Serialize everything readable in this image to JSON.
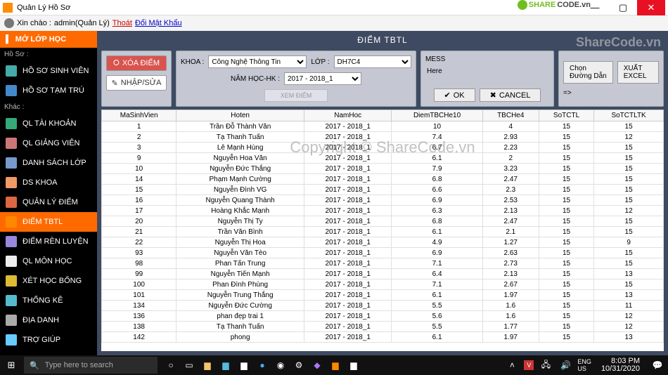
{
  "window": {
    "title": "Quản Lý Hồ Sơ"
  },
  "user": {
    "prefix": "Xin chào :",
    "name": "admin(Quản Lý)",
    "logout": "Thoát",
    "changepw": "Đổi Mật Khẩu"
  },
  "sidebar": {
    "header": "MỞ LỚP HỌC",
    "group1_label": "Hồ Sơ :",
    "group2_label": "Khác :",
    "items1": [
      {
        "label": "HỒ SƠ SINH VIÊN",
        "color": "#4aa"
      },
      {
        "label": "HỒ SƠ TẠM TRÚ",
        "color": "#48c"
      }
    ],
    "items2": [
      {
        "label": "QL TÀI KHOẢN",
        "color": "#3a7"
      },
      {
        "label": "QL GIẢNG VIÊN",
        "color": "#c77"
      },
      {
        "label": "DANH SÁCH LỚP",
        "color": "#79c"
      },
      {
        "label": "DS KHOA",
        "color": "#e96"
      },
      {
        "label": "QUẢN LÝ ĐIỂM",
        "color": "#d64"
      },
      {
        "label": "ĐIỂM TBTL",
        "color": "#f80",
        "active": true
      },
      {
        "label": "ĐIỂM RÈN LUYỆN",
        "color": "#98d"
      },
      {
        "label": "QL MÔN HỌC",
        "color": "#eee"
      },
      {
        "label": "XÉT HỌC BỔNG",
        "color": "#db3"
      },
      {
        "label": "THỐNG KÊ",
        "color": "#5bc"
      },
      {
        "label": "ĐỊA DANH",
        "color": "#aaa"
      },
      {
        "label": "TRỢ GIÚP",
        "color": "#6cf"
      }
    ]
  },
  "page": {
    "title": "ĐIỂM TBTL"
  },
  "leftbtns": {
    "xd": "XÓA ĐIỂM",
    "ns": "NHẬP/SỬA"
  },
  "filters": {
    "khoa_label": "KHOA :",
    "khoa_value": "Công Nghệ Thông Tin",
    "lop_label": "LỚP :",
    "lop_value": "DH7C4",
    "nam_label": "NĂM HỌC-HK :",
    "nam_value": "2017 - 2018_1",
    "xem": "XEM ĐIỂM"
  },
  "mess": {
    "label": "MESS",
    "text": "Here",
    "ok": "OK",
    "cancel": "CANCEL"
  },
  "export": {
    "path": "Chọn Đường Dẫn",
    "excel": "XUẤT EXCEL",
    "arrow": "=>"
  },
  "table": {
    "headers": [
      "MaSinhVien",
      "Hoten",
      "NamHoc",
      "DiemTBCHe10",
      "TBCHe4",
      "SoTCTL",
      "SoTCTLTK"
    ],
    "rows": [
      [
        "1",
        "Trần Đỗ Thành Văn",
        "2017 - 2018_1",
        "10",
        "4",
        "15",
        "15"
      ],
      [
        "2",
        "Tạ Thanh Tuấn",
        "2017 - 2018_1",
        "7.4",
        "2.93",
        "15",
        "12"
      ],
      [
        "3",
        "Lê Mạnh Hùng",
        "2017 - 2018_1",
        "6.7",
        "2.23",
        "15",
        "15"
      ],
      [
        "9",
        "Nguyễn Hoa Văn",
        "2017 - 2018_1",
        "6.1",
        "2",
        "15",
        "15"
      ],
      [
        "10",
        "Nguyễn Đức Thắng",
        "2017 - 2018_1",
        "7.9",
        "3.23",
        "15",
        "15"
      ],
      [
        "14",
        "Phạm Mạnh Cường",
        "2017 - 2018_1",
        "6.8",
        "2.47",
        "15",
        "15"
      ],
      [
        "15",
        "Nguyễn Đình VG",
        "2017 - 2018_1",
        "6.6",
        "2.3",
        "15",
        "15"
      ],
      [
        "16",
        "Nguyễn Quang Thành",
        "2017 - 2018_1",
        "6.9",
        "2.53",
        "15",
        "15"
      ],
      [
        "17",
        "Hoàng Khắc Mạnh",
        "2017 - 2018_1",
        "6.3",
        "2.13",
        "15",
        "12"
      ],
      [
        "20",
        "Nguyễn Thị Ty",
        "2017 - 2018_1",
        "6.8",
        "2.47",
        "15",
        "15"
      ],
      [
        "21",
        "Trần Văn Bình",
        "2017 - 2018_1",
        "6.1",
        "2.1",
        "15",
        "15"
      ],
      [
        "22",
        "Nguyễn Thị Hoa",
        "2017 - 2018_1",
        "4.9",
        "1.27",
        "15",
        "9"
      ],
      [
        "93",
        "Nguyễn Văn Tèo",
        "2017 - 2018_1",
        "6.9",
        "2.63",
        "15",
        "15"
      ],
      [
        "98",
        "Phan Tấn Trung",
        "2017 - 2018_1",
        "7.1",
        "2.73",
        "15",
        "15"
      ],
      [
        "99",
        "Nguyễn Tiến Mạnh",
        "2017 - 2018_1",
        "6.4",
        "2.13",
        "15",
        "13"
      ],
      [
        "100",
        "Phan Đình Phùng",
        "2017 - 2018_1",
        "7.1",
        "2.67",
        "15",
        "15"
      ],
      [
        "101",
        "Nguyễn Trung Thắng",
        "2017 - 2018_1",
        "6.1",
        "1.97",
        "15",
        "13"
      ],
      [
        "134",
        "Nguyễn Đức Cường",
        "2017 - 2018_1",
        "5.5",
        "1.6",
        "15",
        "11"
      ],
      [
        "136",
        "phan đẹp trai 1",
        "2017 - 2018_1",
        "5.6",
        "1.6",
        "15",
        "12"
      ],
      [
        "138",
        "Tạ Thanh Tuấn",
        "2017 - 2018_1",
        "5.5",
        "1.77",
        "15",
        "12"
      ],
      [
        "142",
        "phong",
        "2017 - 2018_1",
        "6.1",
        "1.97",
        "15",
        "13"
      ]
    ]
  },
  "watermark": {
    "center": "Copyright © ShareCode.vn",
    "topright": "ShareCode.vn",
    "brand1": "SHARE",
    "brand2": "CODE.vn"
  },
  "taskbar": {
    "search_placeholder": "Type here to search",
    "lang": "ENG\nUS",
    "time": "8:03 PM",
    "date": "10/31/2020"
  }
}
